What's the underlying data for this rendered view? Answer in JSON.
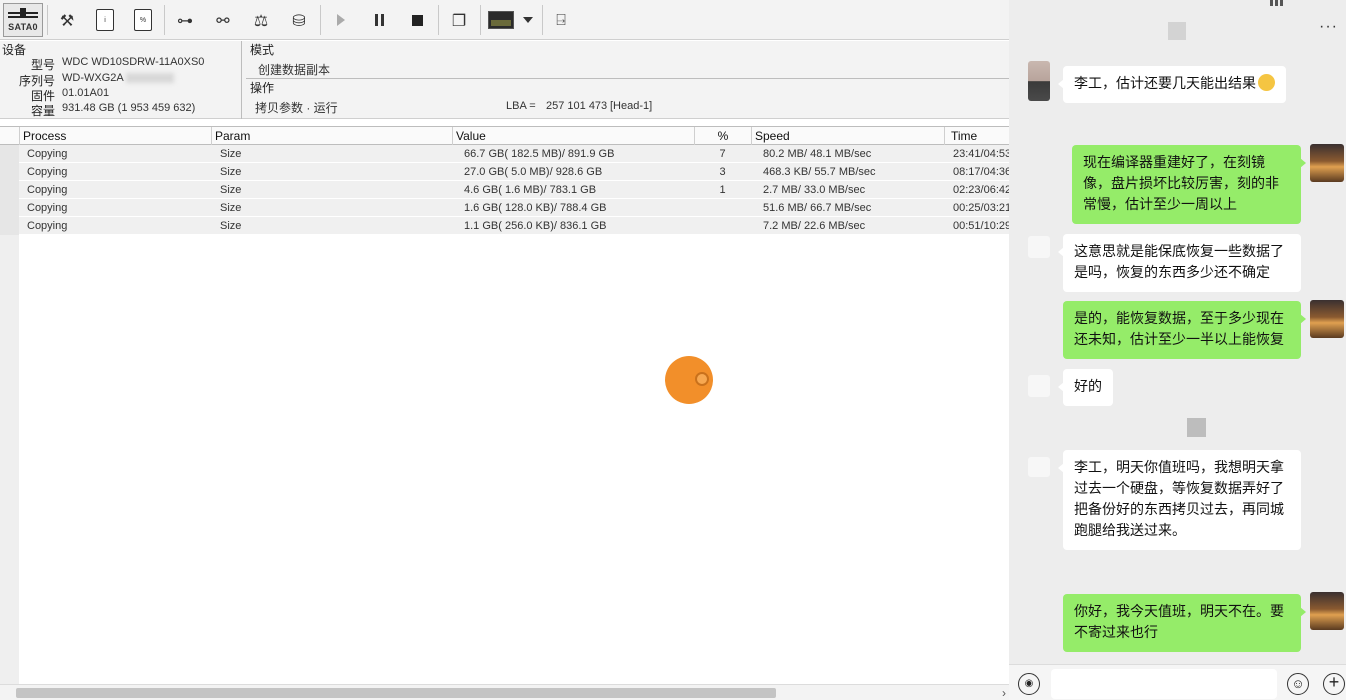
{
  "toolbar": {
    "port_label": "SATA0",
    "icons": [
      "settings-tools-icon",
      "sd-card-icon",
      "percent-card-icon",
      "tree-icon",
      "binoculars-icon",
      "scale-icon",
      "disk-export-icon",
      "play-icon",
      "pause-icon",
      "stop-icon",
      "copy-windows-icon",
      "monitor-icon",
      "dropdown-icon",
      "exit-icon"
    ]
  },
  "device": {
    "title": "设备",
    "model_label": "型号",
    "model": "WDC WD10SDRW-11A0XS0",
    "serial_label": "序列号",
    "serial": "WD-WXG2A",
    "firmware_label": "固件",
    "firmware": "01.01A01",
    "capacity_label": "容量",
    "capacity": "931.48 GB (1 953 459 632)"
  },
  "mode": {
    "title": "模式",
    "value": "创建数据副本"
  },
  "operation": {
    "title": "操作",
    "value": "拷贝参数 · 运行",
    "lba_label": "LBA =",
    "lba_value": "257 101 473",
    "head": "[Head-1]"
  },
  "table": {
    "columns": [
      "Process",
      "Param",
      "Value",
      "%",
      "Speed",
      "Time"
    ],
    "rows": [
      {
        "process": "Copying",
        "param": "Size",
        "value": "66.7 GB( 182.5 MB)/ 891.9 GB",
        "pct": "7",
        "speed": "80.2 MB/ 48.1 MB/sec",
        "time": "23:41/04:53"
      },
      {
        "process": "Copying",
        "param": "Size",
        "value": "27.0 GB( 5.0 MB)/ 928.6 GB",
        "pct": "3",
        "speed": "468.3 KB/ 55.7 MB/sec",
        "time": "08:17/04:36"
      },
      {
        "process": "Copying",
        "param": "Size",
        "value": "4.6 GB( 1.6 MB)/ 783.1 GB",
        "pct": "1",
        "speed": "2.7 MB/ 33.0 MB/sec",
        "time": "02:23/06:42"
      },
      {
        "process": "Copying",
        "param": "Size",
        "value": "1.6 GB( 128.0 KB)/ 788.4 GB",
        "pct": "",
        "speed": "51.6 MB/ 66.7 MB/sec",
        "time": "00:25/03:21"
      },
      {
        "process": "Copying",
        "param": "Size",
        "value": "1.1 GB( 256.0 KB)/ 836.1 GB",
        "pct": "",
        "speed": "7.2 MB/ 22.6 MB/sec",
        "time": "00:51/10:29"
      }
    ]
  },
  "chat": {
    "more": "···",
    "messages": [
      {
        "side": "other",
        "text": "李工，估计还要几天能出结果"
      },
      {
        "side": "self",
        "text": "现在编译器重建好了，在刻镜像，盘片损坏比较厉害，刻的非常慢，估计至少一周以上"
      },
      {
        "side": "other",
        "text": "这意思就是能保底恢复一些数据了是吗，恢复的东西多少还不确定"
      },
      {
        "side": "self",
        "text": "是的，能恢复数据，至于多少现在还未知，估计至少一半以上能恢复"
      },
      {
        "side": "other",
        "text": "好的"
      },
      {
        "side": "other",
        "text": "李工，明天你值班吗，我想明天拿过去一个硬盘，等恢复数据弄好了把备份好的东西拷贝过去，再同城跑腿给我送过来。"
      },
      {
        "side": "self",
        "text": "你好，我今天值班，明天不在。要不寄过来也行"
      }
    ],
    "input_placeholder": ""
  }
}
